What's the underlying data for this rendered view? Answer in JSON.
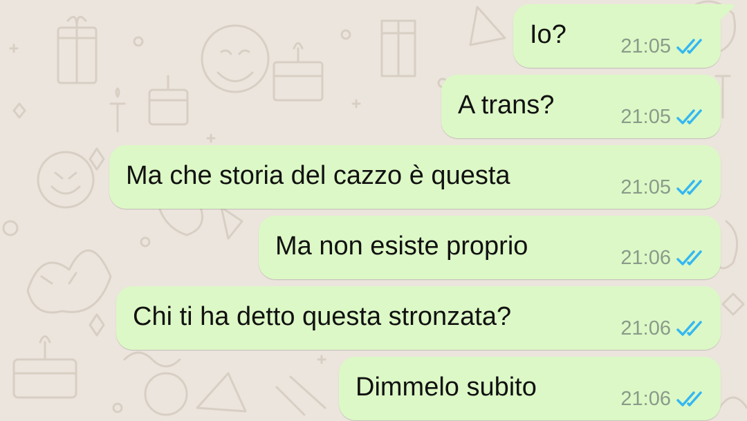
{
  "chat": {
    "messages": [
      {
        "text": "Io?",
        "time": "21:05",
        "status": "read"
      },
      {
        "text": "A trans?",
        "time": "21:05",
        "status": "read"
      },
      {
        "text": "Ma che storia del cazzo è questa",
        "time": "21:05",
        "status": "read"
      },
      {
        "text": "Ma non esiste proprio",
        "time": "21:06",
        "status": "read"
      },
      {
        "text": "Chi ti ha detto questa stronzata?",
        "time": "21:06",
        "status": "read"
      },
      {
        "text": "Dimmelo subito",
        "time": "21:06",
        "status": "read"
      }
    ]
  },
  "colors": {
    "wallpaper": "#ece5dd",
    "bubble_outgoing": "#dcf8c6",
    "read_ticks": "#34b7f1",
    "timestamp": "#8a9a8a"
  },
  "icons": {
    "status": "double-check-icon",
    "wallpaper": "doodle-pattern"
  }
}
